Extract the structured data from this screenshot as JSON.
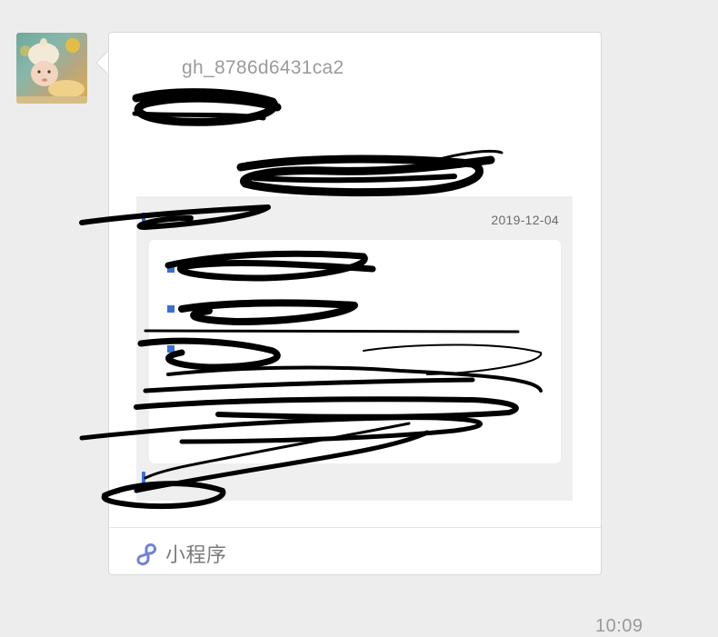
{
  "message": {
    "sender": "gh_8786d6431ca2",
    "preview": {
      "date": "2019-12-04"
    },
    "footer_label": "小程序"
  },
  "time": "10:09",
  "colors": {
    "accent": "#3a6fd6",
    "mini_program_icon": "#6d83d6",
    "background": "#ededed"
  }
}
